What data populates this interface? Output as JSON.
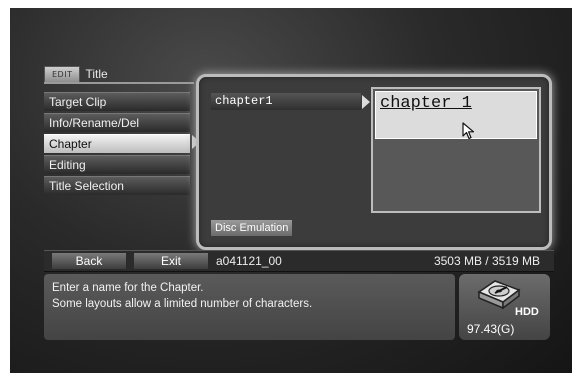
{
  "header": {
    "badge": "EDIT",
    "title": "Title"
  },
  "menu": {
    "items": [
      {
        "label": "Target Clip"
      },
      {
        "label": "Info/Rename/Del"
      },
      {
        "label": "Chapter"
      },
      {
        "label": "Editing"
      },
      {
        "label": "Title Selection"
      }
    ],
    "selected": "Chapter"
  },
  "panel": {
    "chapter_item": "chapter1",
    "name_value": "chapter_1",
    "disc_emulation": "Disc Emulation"
  },
  "bottom_bar": {
    "back_label": "Back",
    "exit_label": "Exit",
    "clip_name": "a041121_00",
    "capacity": "3503 MB / 3519 MB"
  },
  "message": {
    "line1": "Enter a name for the Chapter.",
    "line2": "Some layouts allow a limited number of characters."
  },
  "hdd": {
    "label": "HDD",
    "free_space": "97.43(G)",
    "icon": "hdd-icon"
  }
}
